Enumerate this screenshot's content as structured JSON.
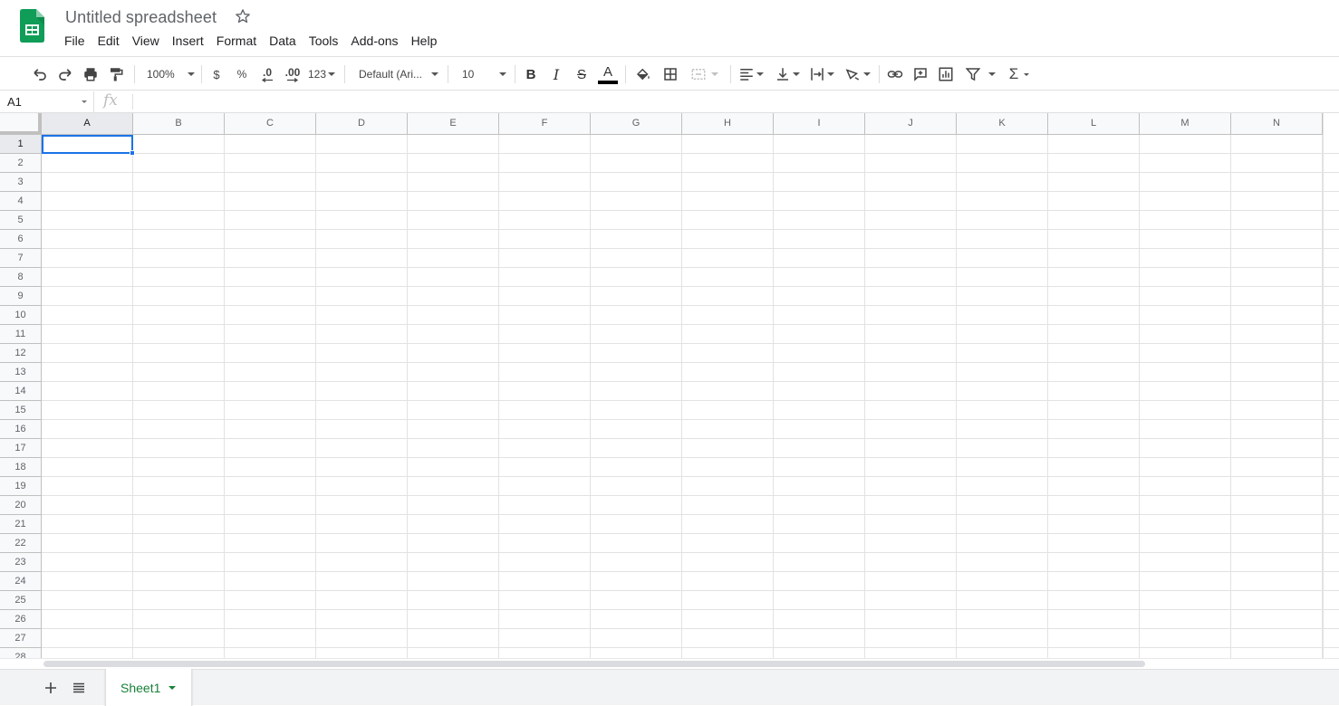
{
  "document": {
    "title": "Untitled spreadsheet"
  },
  "menu": [
    "File",
    "Edit",
    "View",
    "Insert",
    "Format",
    "Data",
    "Tools",
    "Add-ons",
    "Help"
  ],
  "toolbar": {
    "zoom": "100%",
    "currency": "$",
    "percent": "%",
    "decrease_decimal": ".0",
    "increase_decimal": ".00",
    "more_formats": "123",
    "font": "Default (Ari...",
    "font_size": "10",
    "bold": "B",
    "italic": "I",
    "strikethrough": "S",
    "text_color_letter": "A",
    "sum": "Σ"
  },
  "formula_bar": {
    "cell_ref": "A1",
    "fx": "fx",
    "value": ""
  },
  "grid": {
    "columns": [
      "A",
      "B",
      "C",
      "D",
      "E",
      "F",
      "G",
      "H",
      "I",
      "J",
      "K",
      "L",
      "M",
      "N"
    ],
    "rows": [
      "1",
      "2",
      "3",
      "4",
      "5",
      "6",
      "7",
      "8",
      "9",
      "10",
      "11",
      "12",
      "13",
      "14",
      "15",
      "16",
      "17",
      "18",
      "19",
      "20",
      "21",
      "22",
      "23",
      "24",
      "25",
      "26",
      "27",
      "28"
    ],
    "selected_cell": "A1"
  },
  "sheets": {
    "tabs": [
      "Sheet1"
    ],
    "active": "Sheet1"
  },
  "colors": {
    "brand_green": "#0f9d58",
    "selection_blue": "#1a73e8",
    "tab_green": "#188038"
  }
}
